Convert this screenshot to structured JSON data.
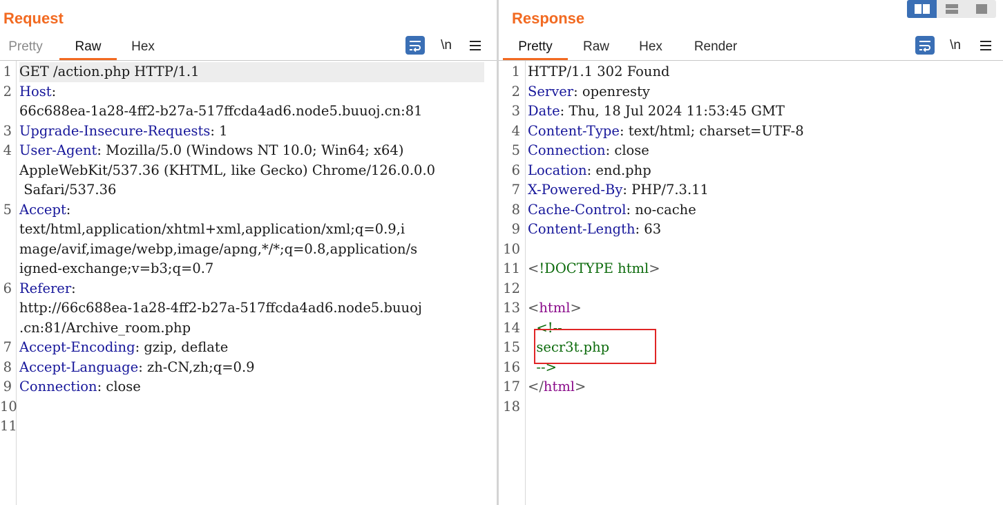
{
  "request": {
    "title": "Request",
    "tabs": [
      "Pretty",
      "Raw",
      "Hex"
    ],
    "active_tab": "Raw",
    "newline_label": "\\n",
    "lines": [
      {
        "n": "1",
        "parts": [
          [
            "p",
            "GET /action.php HTTP/1.1"
          ]
        ]
      },
      {
        "n": "2",
        "parts": [
          [
            "k",
            "Host"
          ],
          [
            "p",
            ":"
          ]
        ]
      },
      {
        "n": "",
        "parts": [
          [
            "p",
            "66c688ea-1a28-4ff2-b27a-517ffcda4ad6.node5.buuoj.cn:81"
          ]
        ]
      },
      {
        "n": "3",
        "parts": [
          [
            "k",
            "Upgrade-Insecure-Requests"
          ],
          [
            "p",
            ": 1"
          ]
        ]
      },
      {
        "n": "4",
        "parts": [
          [
            "k",
            "User-Agent"
          ],
          [
            "p",
            ": Mozilla/5.0 (Windows NT 10.0; Win64; x64)"
          ]
        ]
      },
      {
        "n": "",
        "parts": [
          [
            "p",
            "AppleWebKit/537.36 (KHTML, like Gecko) Chrome/126.0.0.0"
          ]
        ]
      },
      {
        "n": "",
        "parts": [
          [
            "p",
            " Safari/537.36"
          ]
        ]
      },
      {
        "n": "5",
        "parts": [
          [
            "k",
            "Accept"
          ],
          [
            "p",
            ":"
          ]
        ]
      },
      {
        "n": "",
        "parts": [
          [
            "p",
            "text/html,application/xhtml+xml,application/xml;q=0.9,i"
          ]
        ]
      },
      {
        "n": "",
        "parts": [
          [
            "p",
            "mage/avif,image/webp,image/apng,*/*;q=0.8,application/s"
          ]
        ]
      },
      {
        "n": "",
        "parts": [
          [
            "p",
            "igned-exchange;v=b3;q=0.7"
          ]
        ]
      },
      {
        "n": "6",
        "parts": [
          [
            "k",
            "Referer"
          ],
          [
            "p",
            ":"
          ]
        ]
      },
      {
        "n": "",
        "parts": [
          [
            "p",
            "http://66c688ea-1a28-4ff2-b27a-517ffcda4ad6.node5.buuoj"
          ]
        ]
      },
      {
        "n": "",
        "parts": [
          [
            "p",
            ".cn:81/Archive_room.php"
          ]
        ]
      },
      {
        "n": "7",
        "parts": [
          [
            "k",
            "Accept-Encoding"
          ],
          [
            "p",
            ": gzip, deflate"
          ]
        ]
      },
      {
        "n": "8",
        "parts": [
          [
            "k",
            "Accept-Language"
          ],
          [
            "p",
            ": zh-CN,zh;q=0.9"
          ]
        ]
      },
      {
        "n": "9",
        "parts": [
          [
            "k",
            "Connection"
          ],
          [
            "p",
            ": close"
          ]
        ]
      },
      {
        "n": "10",
        "parts": []
      },
      {
        "n": "11",
        "parts": []
      }
    ]
  },
  "response": {
    "title": "Response",
    "tabs": [
      "Pretty",
      "Raw",
      "Hex",
      "Render"
    ],
    "active_tab": "Pretty",
    "newline_label": "\\n",
    "lines": [
      {
        "n": "1",
        "parts": [
          [
            "p",
            "HTTP/1.1 302 Found"
          ]
        ]
      },
      {
        "n": "2",
        "parts": [
          [
            "k",
            "Server"
          ],
          [
            "p",
            ": openresty"
          ]
        ]
      },
      {
        "n": "3",
        "parts": [
          [
            "k",
            "Date"
          ],
          [
            "p",
            ": Thu, 18 Jul 2024 11:53:45 GMT"
          ]
        ]
      },
      {
        "n": "4",
        "parts": [
          [
            "k",
            "Content-Type"
          ],
          [
            "p",
            ": text/html; charset=UTF-8"
          ]
        ]
      },
      {
        "n": "5",
        "parts": [
          [
            "k",
            "Connection"
          ],
          [
            "p",
            ": close"
          ]
        ]
      },
      {
        "n": "6",
        "parts": [
          [
            "k",
            "Location"
          ],
          [
            "p",
            ": end.php"
          ]
        ]
      },
      {
        "n": "7",
        "parts": [
          [
            "k",
            "X-Powered-By"
          ],
          [
            "p",
            ": PHP/7.3.11"
          ]
        ]
      },
      {
        "n": "8",
        "parts": [
          [
            "k",
            "Cache-Control"
          ],
          [
            "p",
            ": no-cache"
          ]
        ]
      },
      {
        "n": "9",
        "parts": [
          [
            "k",
            "Content-Length"
          ],
          [
            "p",
            ": 63"
          ]
        ]
      },
      {
        "n": "10",
        "parts": []
      },
      {
        "n": "11",
        "parts": [
          [
            "g",
            "<"
          ],
          [
            "d",
            "!DOCTYPE html"
          ],
          [
            "g",
            ">"
          ]
        ]
      },
      {
        "n": "12",
        "parts": []
      },
      {
        "n": "13",
        "parts": [
          [
            "g",
            "<"
          ],
          [
            "t",
            "html"
          ],
          [
            "g",
            ">"
          ]
        ]
      },
      {
        "n": "14",
        "parts": [
          [
            "c",
            "  <!--"
          ]
        ]
      },
      {
        "n": "15",
        "parts": [
          [
            "c",
            "  secr3t.php"
          ]
        ]
      },
      {
        "n": "16",
        "parts": [
          [
            "c",
            "  -->"
          ]
        ]
      },
      {
        "n": "17",
        "parts": [
          [
            "g",
            "</"
          ],
          [
            "t",
            "html"
          ],
          [
            "g",
            ">"
          ]
        ]
      },
      {
        "n": "18",
        "parts": []
      }
    ]
  },
  "colors": {
    "accent": "#f26a21",
    "toolbar_blue": "#3a6fb5",
    "header_key": "#16169a",
    "tag": "#8a0b8a",
    "comment": "#0b6a0b",
    "annotation": "#e02525"
  }
}
